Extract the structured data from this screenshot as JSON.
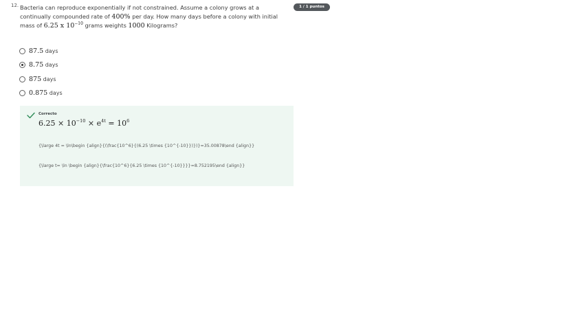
{
  "question": {
    "number": "12.",
    "text_part1": "Bacteria can reproduce exponentially if not constrained. Assume a colony grows at a continually compounded rate of ",
    "rate": "400%",
    "text_part2": " per day. How many days before a colony with initial mass of ",
    "mass_coeff": "6.25",
    "mass_times": " x ",
    "mass_base": "10",
    "mass_exp": "−10",
    "text_part3": " grams weights ",
    "target_mass": "1000",
    "text_part4": " Kilograms?"
  },
  "score_badge": "1 / 1 puntos",
  "options": [
    {
      "value": "87.5",
      "unit": " days",
      "selected": false
    },
    {
      "value": "8.75",
      "unit": " days",
      "selected": true
    },
    {
      "value": "875",
      "unit": " days",
      "selected": false
    },
    {
      "value": "0.875",
      "unit": " days",
      "selected": false
    }
  ],
  "feedback": {
    "status": "Correcto",
    "equation": {
      "coeff": "6.25 × 10",
      "exp1": "−10",
      "mid": " × e",
      "exp2": "4t",
      "eq": " = 10",
      "exp3": "6"
    },
    "latex_line_1": "{\\large 4t = \\ln\\begin {align}{(\\frac{10^6}{(6.25 \\times {10^{-10}})})}=35.00878\\end {align}}",
    "latex_line_2": "{\\large t= \\ln \\begin {align}{\\frac{10^6}{6.25 \\times {10^{-10}}}}=8.752195\\end {align}}"
  },
  "colors": {
    "feedback_bg": "#eef7f2",
    "check_green": "#2e8b57",
    "badge_bg": "#54585c"
  }
}
